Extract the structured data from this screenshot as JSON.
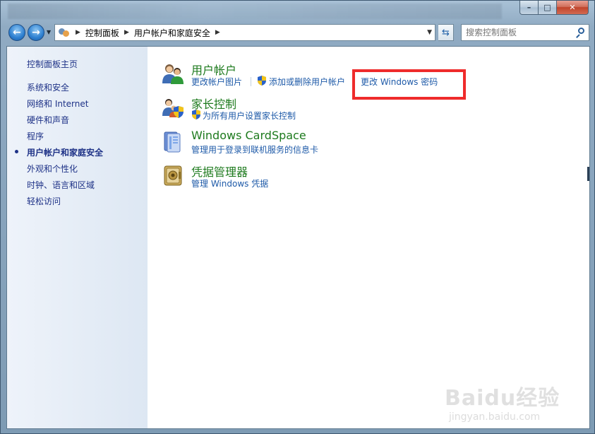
{
  "window": {
    "caption_buttons": {
      "minimize": "–",
      "maximize": "□",
      "close": "✕"
    }
  },
  "navbar": {
    "back_icon": "back-arrow-icon",
    "forward_icon": "forward-arrow-icon",
    "breadcrumb": [
      "控制面板",
      "用户帐户和家庭安全"
    ],
    "search_placeholder": "搜索控制面板"
  },
  "sidebar": {
    "home": "控制面板主页",
    "items": [
      {
        "label": "系统和安全",
        "active": false
      },
      {
        "label": "网络和 Internet",
        "active": false
      },
      {
        "label": "硬件和声音",
        "active": false
      },
      {
        "label": "程序",
        "active": false
      },
      {
        "label": "用户帐户和家庭安全",
        "active": true
      },
      {
        "label": "外观和个性化",
        "active": false
      },
      {
        "label": "时钟、语言和区域",
        "active": false
      },
      {
        "label": "轻松访问",
        "active": false
      }
    ]
  },
  "categories": [
    {
      "title": "用户帐户",
      "icon": "user-accounts-icon",
      "links": [
        "更改帐户图片",
        "添加或删除用户帐户",
        "更改 Windows 密码"
      ]
    },
    {
      "title": "家长控制",
      "icon": "parental-controls-icon",
      "links": [
        "为所有用户设置家长控制"
      ]
    },
    {
      "title": "Windows CardSpace",
      "icon": "cardspace-icon",
      "links": [
        "管理用于登录到联机服务的信息卡"
      ]
    },
    {
      "title": "凭据管理器",
      "icon": "credential-manager-icon",
      "links": [
        "管理 Windows 凭据"
      ]
    }
  ],
  "watermark": {
    "top": "Baidu经验",
    "bottom": "jingyan.baidu.com"
  },
  "colors": {
    "highlight": "#ef2b2b",
    "link": "#1e5aa8",
    "category_title": "#1d7a1d"
  }
}
